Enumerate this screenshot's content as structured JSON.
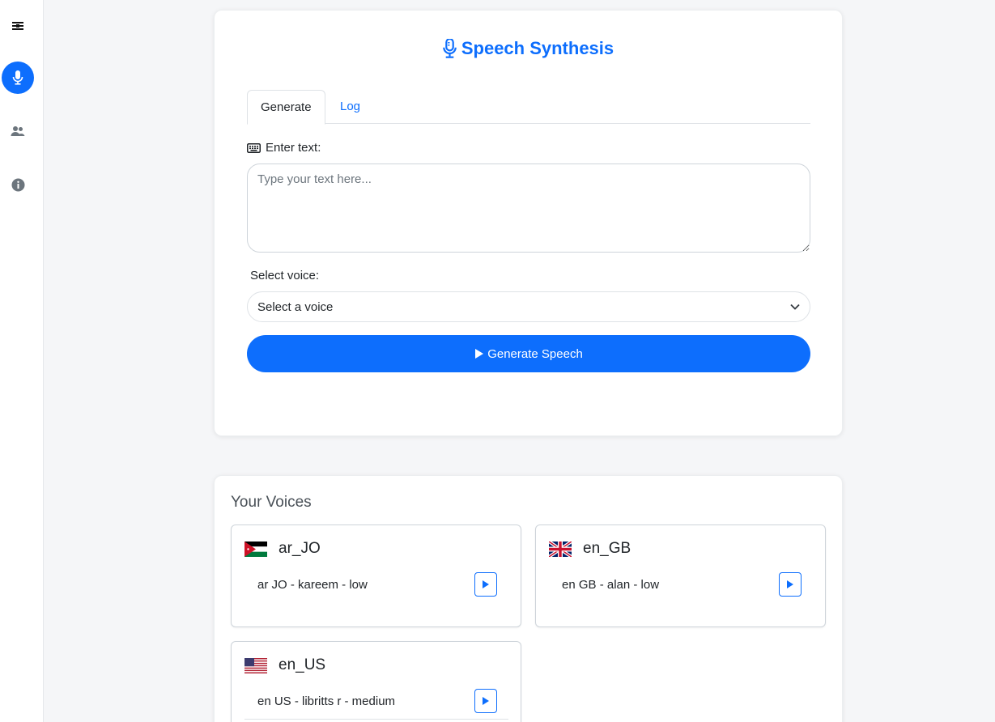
{
  "sidebar": {
    "items": [
      {
        "icon": "sliders-icon"
      },
      {
        "icon": "microphone-icon",
        "active": true
      },
      {
        "icon": "users-icon"
      },
      {
        "icon": "info-icon"
      }
    ]
  },
  "header": {
    "title": "Speech Synthesis",
    "icon": "microphone-icon"
  },
  "tabs": [
    {
      "label": "Generate",
      "active": true
    },
    {
      "label": "Log",
      "active": false
    }
  ],
  "form": {
    "text_label": "Enter text:",
    "text_placeholder": "Type your text here...",
    "text_value": "",
    "voice_label": "Select voice:",
    "voice_selected": "Select a voice",
    "generate_label": "Generate Speech"
  },
  "voices": {
    "title": "Your Voices",
    "groups": [
      {
        "locale": "ar_JO",
        "flag": "jordan-flag",
        "items": [
          {
            "name": "ar JO - kareem - low"
          }
        ]
      },
      {
        "locale": "en_GB",
        "flag": "uk-flag",
        "items": [
          {
            "name": "en GB - alan - low"
          }
        ]
      },
      {
        "locale": "en_US",
        "flag": "us-flag",
        "items": [
          {
            "name": "en US - libritts r - medium"
          }
        ]
      }
    ]
  },
  "colors": {
    "accent": "#0d6efd",
    "background": "#f5f6f8",
    "card": "#ffffff"
  }
}
